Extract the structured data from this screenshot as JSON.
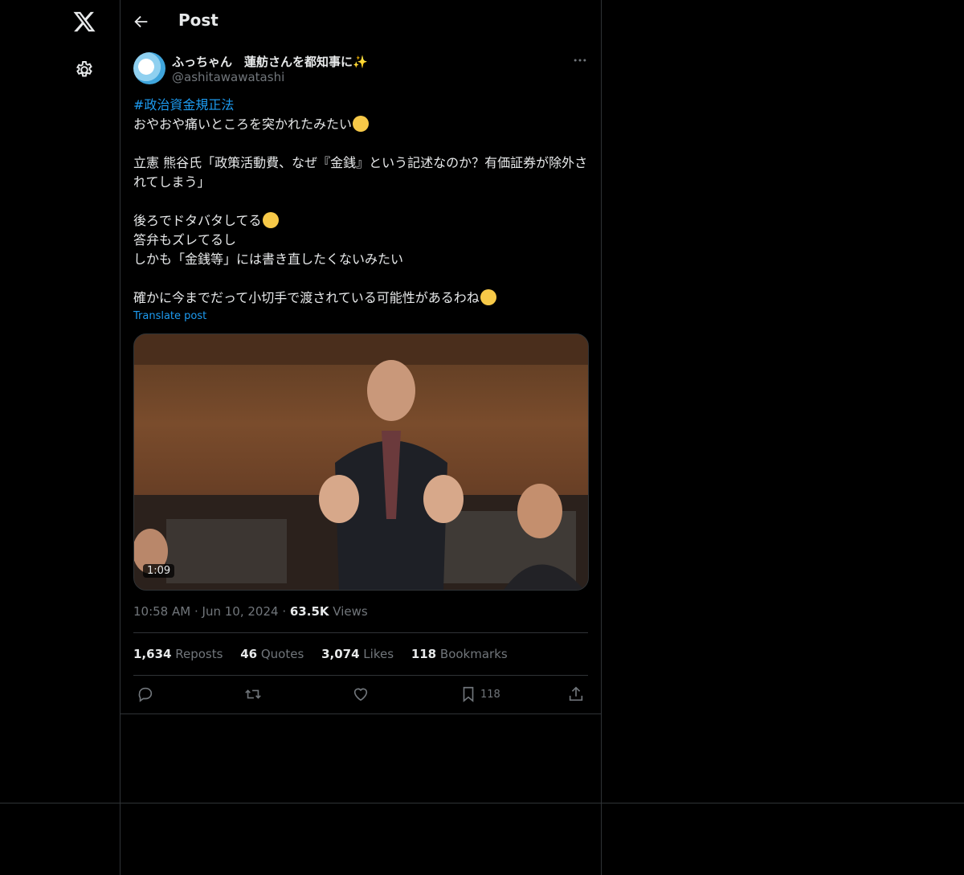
{
  "header": {
    "title": "Post"
  },
  "author": {
    "name": "ふっちゃん　蓮舫さんを都知事に",
    "name_emoji": "✨",
    "handle": "@ashitawawatashi"
  },
  "post": {
    "hashtag": "#政治資金規正法",
    "line1": "おやおや痛いところを突かれたみたい",
    "para2": "立憲 熊谷氏「政策活動費、なぜ『金銭』という記述なのか？有価証券が除外されてしまう」",
    "line3": "後ろでドタバタしてる",
    "line4": "答弁もズレてるし",
    "line5": "しかも「金銭等」には書き直したくないみたい",
    "line6": "確かに今までだって小切手で渡されている可能性があるわね",
    "translate": "Translate post"
  },
  "video": {
    "duration": "1:09"
  },
  "meta": {
    "time": "10:58 AM",
    "date": "Jun 10, 2024",
    "views_count": "63.5K",
    "views_label": "Views"
  },
  "stats": {
    "reposts_count": "1,634",
    "reposts_label": "Reposts",
    "quotes_count": "46",
    "quotes_label": "Quotes",
    "likes_count": "3,074",
    "likes_label": "Likes",
    "bookmarks_count": "118",
    "bookmarks_label": "Bookmarks"
  },
  "actions": {
    "bookmark_count": "118"
  },
  "icons": [
    "x-logo-icon",
    "settings-icon",
    "back-arrow-icon",
    "more-icon",
    "reply-icon",
    "repost-icon",
    "like-icon",
    "bookmark-icon",
    "share-icon"
  ],
  "colors": {
    "background": "#000000",
    "text": "#e7e9ea",
    "muted": "#71767b",
    "accent": "#1d9bf0",
    "border": "#2f3336"
  }
}
